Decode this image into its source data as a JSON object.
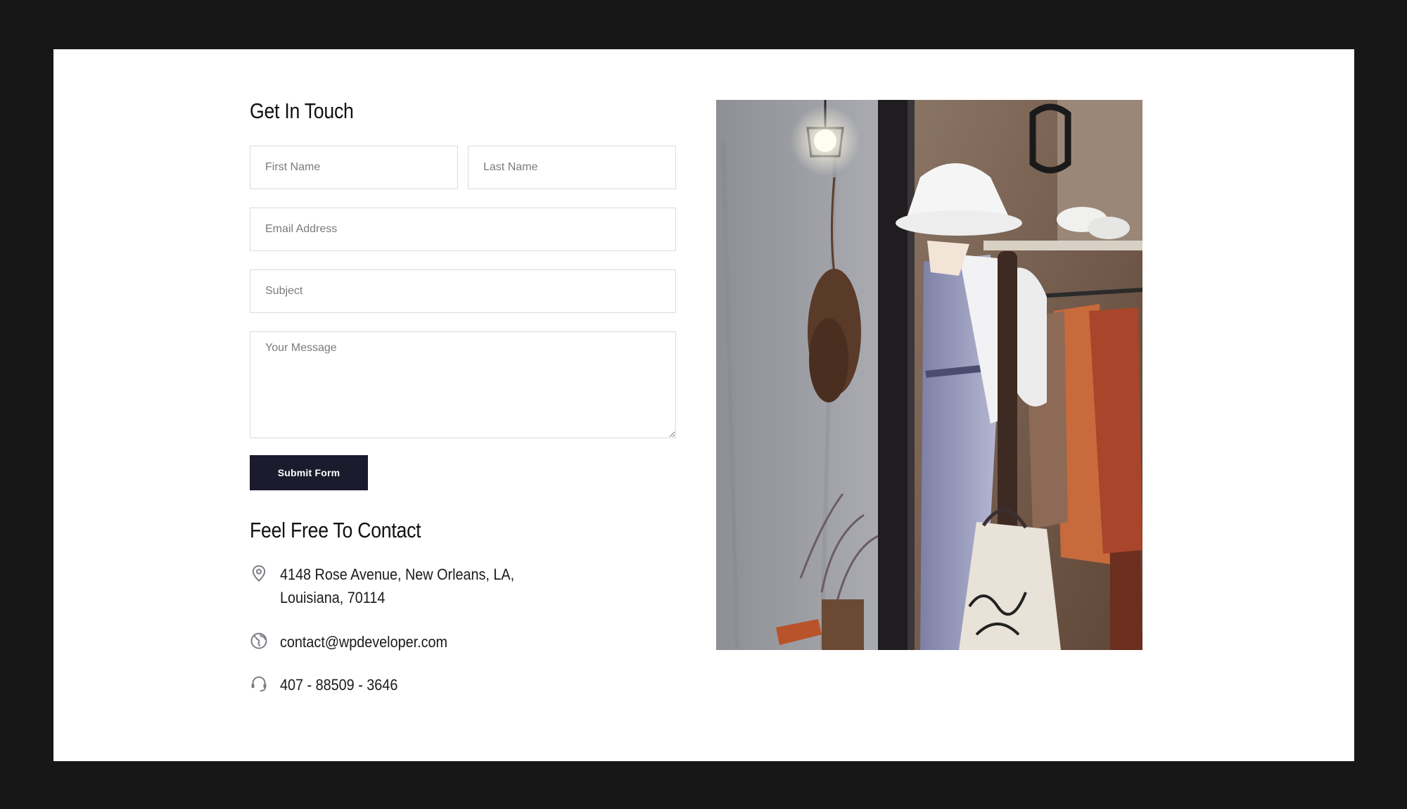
{
  "form": {
    "title": "Get In Touch",
    "first_name_placeholder": "First Name",
    "last_name_placeholder": "Last Name",
    "email_placeholder": "Email Address",
    "subject_placeholder": "Subject",
    "message_placeholder": "Your Message",
    "submit_label": "Submit Form"
  },
  "contact": {
    "title": "Feel Free To Contact",
    "address_line1": "4148 Rose Avenue, New Orleans, LA,",
    "address_line2": "Louisiana, 70114",
    "email": "contact@wpdeveloper.com",
    "phone": "407 - 88509 - 3646",
    "icons": {
      "address": "map-pin-icon",
      "email": "globe-icon",
      "phone": "headset-icon"
    }
  },
  "colors": {
    "page_background": "#171717",
    "card_background": "#ffffff",
    "button_background": "#1b1b2d",
    "field_border": "#dcdcdc",
    "icon_color": "#7d7d86"
  }
}
